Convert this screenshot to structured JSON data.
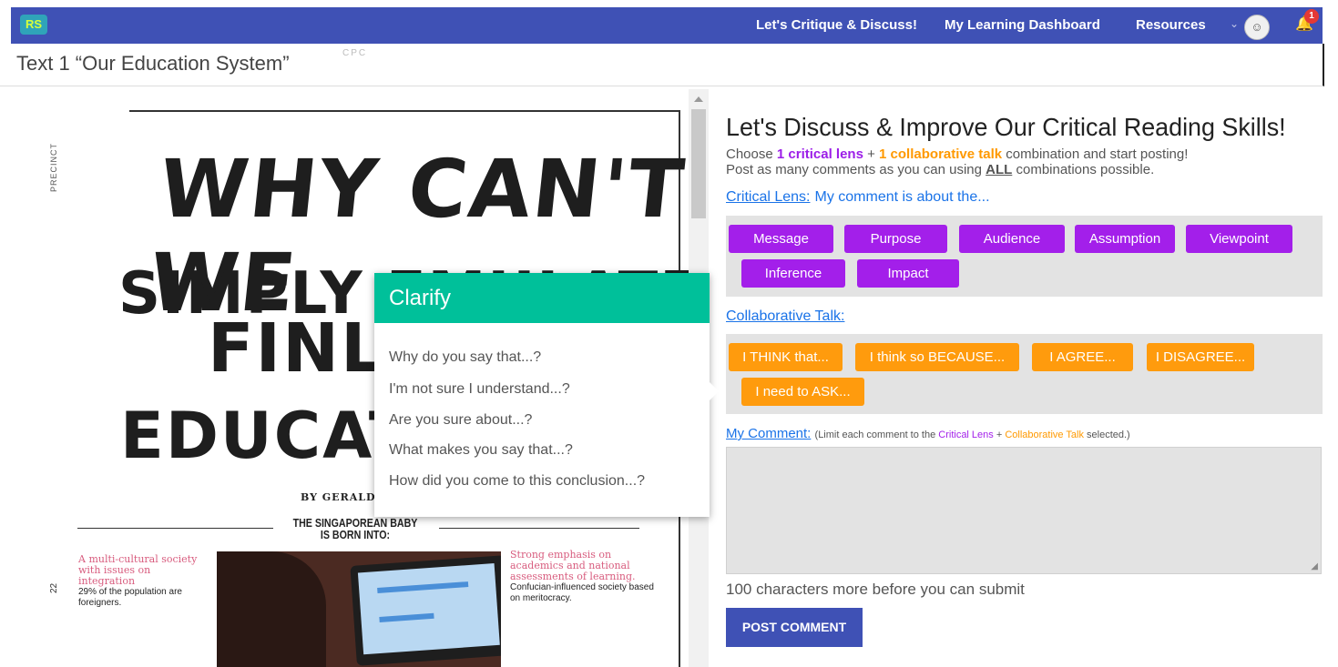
{
  "header": {
    "logo_text": "RS",
    "nav": [
      "Let's Critique & Discuss!",
      "My Learning Dashboard",
      "Resources"
    ],
    "chevron_icon": "chevron-down-icon",
    "notification_count": "1",
    "avatar_icon": "user-avatar-icon",
    "bell_icon": "bell-icon"
  },
  "page": {
    "title": "Text 1 “Our Education System”",
    "faint_text": "CPC"
  },
  "document": {
    "side_label": "PRECINCT",
    "page_number": "22",
    "headline": [
      "WHY CAN'T WE",
      "SIMPLY EMUL",
      "ATE",
      "FINLA",
      "EDUCATIO"
    ],
    "byline": "BY GERALD F",
    "subhead": "THE SINGAPOREAN BABY IS BORN INTO:",
    "left_col_pink": "A multi-cultural society with issues on integration",
    "left_col_text": "29% of the population are foreigners.",
    "right_col_pink": "Strong emphasis on academics and national assessments of learning.",
    "right_col_text": "Confucian-influenced society based on meritocracy."
  },
  "popup": {
    "title": "Clarify",
    "items": [
      "Why do you say that...?",
      "I'm not sure I understand...?",
      "Are you sure about...?",
      "What makes you say that...?",
      "How did you come to this conclusion...?"
    ]
  },
  "panel": {
    "title": "Let's Discuss & Improve Our Critical Reading Skills!",
    "intro_1a": "Choose ",
    "intro_1b": "1 critical lens",
    "intro_1c": " + ",
    "intro_1d": "1 collaborative talk",
    "intro_1e": " combination and start posting!",
    "intro_2a": "Post as many comments as you can using ",
    "intro_2b": "ALL",
    "intro_2c": " combinations possible.",
    "lens_label": "Critical Lens:",
    "lens_hint": "My comment is about the...",
    "lens_buttons": [
      "Message",
      "Purpose",
      "Audience",
      "Assumption",
      "Viewpoint",
      "Inference",
      "Impact"
    ],
    "talk_label": "Collaborative Talk:",
    "talk_buttons": [
      "I THINK that...",
      "I think so BECAUSE...",
      "I AGREE...",
      "I DISAGREE...",
      "I need to ASK..."
    ],
    "comment_label": "My Comment:",
    "comment_note_a": "(Limit each comment to the ",
    "comment_note_b": "Critical Lens",
    "comment_note_c": " + ",
    "comment_note_d": "Collaborative Talk",
    "comment_note_e": " selected.)",
    "chars_left": "100 characters more before you can submit",
    "post_label": "POST COMMENT"
  },
  "colors": {
    "nav": "#3f51b5",
    "lens": "#a31fea",
    "talk": "#ff9b0d",
    "clarify": "#00c09a"
  }
}
